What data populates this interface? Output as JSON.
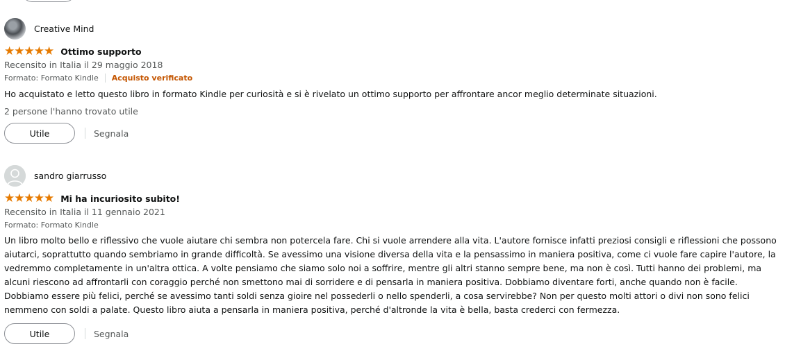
{
  "reviews": [
    {
      "reviewer": "Creative Mind",
      "avatar": "photo-avatar",
      "stars": "★★★★★",
      "rating": 5,
      "title": "Ottimo supporto",
      "date": "Recensito in Italia il 29 maggio 2018",
      "format": "Formato: Formato Kindle",
      "verified": "Acquisto verificato",
      "body": "Ho acquistato e letto questo libro in formato Kindle per curiosità e si è rivelato un ottimo supporto per affrontare ancor meglio determinate situazioni.",
      "helpful": "2 persone l'hanno trovato utile",
      "helpful_button": "Utile",
      "report": "Segnala"
    },
    {
      "reviewer": "sandro giarrusso",
      "avatar": "default-avatar",
      "stars": "★★★★★",
      "rating": 5,
      "title": "Mi ha incuriosito subito!",
      "date": "Recensito in Italia il 11 gennaio 2021",
      "format": "Formato: Formato Kindle",
      "body": "Un libro molto bello e riflessivo che vuole aiutare chi sembra non potercela fare. Chi si vuole arrendere alla vita. L'autore fornisce infatti preziosi consigli e riflessioni che possono aiutarci, soprattutto quando sembriamo in grande difficoltà. Se avessimo una visione diversa della vita e la pensassimo in maniera positiva, come ci vuole fare capire l'autore, la vedremmo completamente in un'altra ottica. A volte pensiamo che siamo solo noi a soffrire, mentre gli altri stanno sempre bene, ma non è così. Tutti hanno dei problemi, ma alcuni riescono ad affrontarli con coraggio perché non smettono mai di sorridere e di pensarla in maniera positiva. Dobbiamo diventare forti, anche quando non è facile. Dobbiamo essere più felici, perché se avessimo tanti soldi senza gioire nel possederli o nello spenderli, a cosa servirebbe? Non per questo molti attori o divi non sono felici nemmeno con soldi a palate. Questo libro aiuta a pensarla in maniera positiva, perché d'altronde la vita è bella, basta crederci con fermezza.",
      "helpful_button": "Utile",
      "report": "Segnala"
    }
  ],
  "colors": {
    "star": "#e67a00",
    "verified": "#c45500",
    "muted": "#565959"
  }
}
